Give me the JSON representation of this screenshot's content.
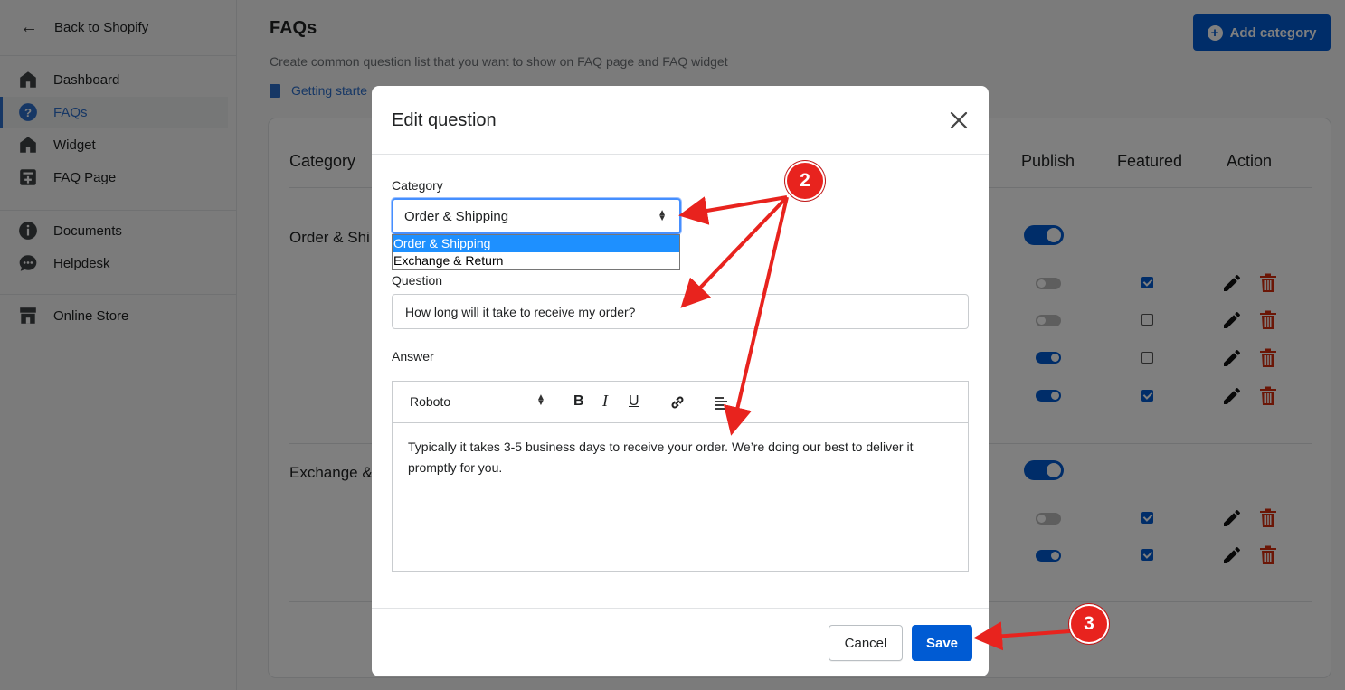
{
  "sidebar": {
    "back_label": "Back to Shopify",
    "items": [
      {
        "label": "Dashboard",
        "icon": "home-icon"
      },
      {
        "label": "FAQs",
        "icon": "question-icon"
      },
      {
        "label": "Widget",
        "icon": "home-icon"
      },
      {
        "label": "FAQ Page",
        "icon": "add-page-icon"
      },
      {
        "label": "Documents",
        "icon": "info-icon"
      },
      {
        "label": "Helpdesk",
        "icon": "chat-icon"
      },
      {
        "label": "Online Store",
        "icon": "store-icon"
      }
    ]
  },
  "main": {
    "title": "FAQs",
    "subtitle": "Create common question list that you want to show on FAQ page and FAQ widget",
    "getting_started": "Getting starte",
    "add_category": "Add category",
    "table": {
      "headers": {
        "category": "Category",
        "publish": "Publish",
        "featured": "Featured",
        "action": "Action"
      },
      "categories": [
        {
          "name": "Order & Shi",
          "published": true,
          "questions": [
            {
              "publish": false,
              "featured": true
            },
            {
              "publish": false,
              "featured": false
            },
            {
              "publish": true,
              "featured": false
            },
            {
              "publish": true,
              "featured": true
            }
          ]
        },
        {
          "name": "Exchange &",
          "published": true,
          "questions": [
            {
              "publish": false,
              "featured": true
            },
            {
              "publish": true,
              "featured": true
            }
          ]
        }
      ]
    }
  },
  "modal": {
    "title": "Edit question",
    "category_label": "Category",
    "category_value": "Order & Shipping",
    "category_options": [
      "Order & Shipping",
      "Exchange & Return"
    ],
    "question_label": "Question",
    "question_value": "How long will it take to receive my order?",
    "answer_label": "Answer",
    "font_value": "Roboto",
    "answer_text": "Typically it takes 3-5 business days to receive your order. We’re doing our best to deliver it promptly for you.",
    "cancel_label": "Cancel",
    "save_label": "Save"
  },
  "annotations": {
    "step2": "2",
    "step3": "3"
  },
  "colors": {
    "primary": "#005bd3",
    "danger": "#d72c0d",
    "annotation": "#e8231e"
  }
}
